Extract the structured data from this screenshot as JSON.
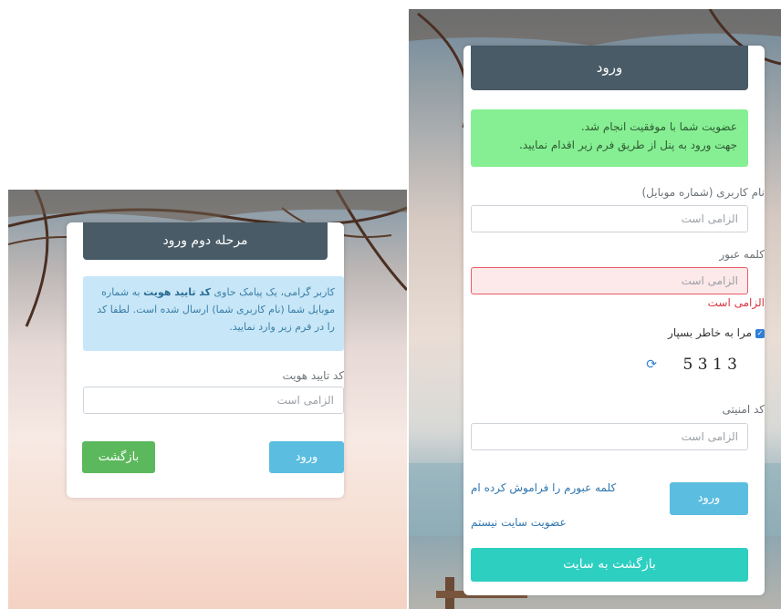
{
  "left": {
    "header": "مرحله دوم ورود",
    "info_pre": "کاربر گرامی، یک پیامک حاوی",
    "info_bold": "کد تایید هویت",
    "info_post": "به شماره موبایل شما (نام کاربری شما) ارسال شده است. لطفا کد را در فرم زیر وارد نمایید.",
    "code_label": "کد تایید هویت",
    "code_placeholder": "الزامی است",
    "login_button": "ورود",
    "back_button": "بازگشت"
  },
  "right": {
    "header": "ورود",
    "success_line1": "عضویت شما با موفقیت انجام شد.",
    "success_line2": "جهت ورود به پنل از طریق فرم زیر اقدام نمایید.",
    "username_label": "نام کاربری (شماره موبایل)",
    "username_placeholder": "الزامی است",
    "password_label": "کلمه عبور",
    "password_placeholder": "الزامی است",
    "password_error": "الزامی است",
    "remember_label": "مرا به خاطر بسپار",
    "captcha_text": "3 1 3 5",
    "refresh_icon": "refresh-icon",
    "captcha_label": "کد امنیتی",
    "captcha_placeholder": "الزامی است",
    "login_button": "ورود",
    "forgot_link": "کلمه عبورم را فراموش کرده ام",
    "register_link": "عضویت سایت نیستم",
    "back_to_site_button": "بازگشت به سایت"
  },
  "colors": {
    "header_bg": "#495b66",
    "info_bg": "#c7e6f7",
    "success_bg": "#86ef93",
    "login_btn": "#5bbde0",
    "back_btn": "#5cb85c",
    "site_btn": "#2dcfc1",
    "error": "#d9343f"
  }
}
